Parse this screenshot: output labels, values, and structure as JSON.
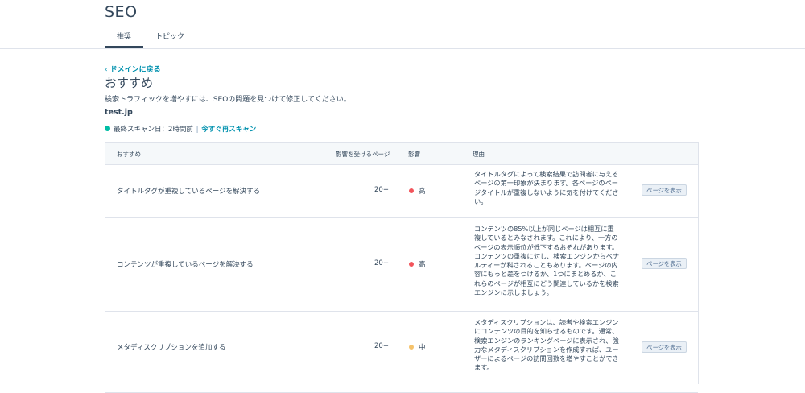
{
  "header": {
    "title": "SEO",
    "tabs": [
      {
        "label": "推奨",
        "active": true
      },
      {
        "label": "トピック",
        "active": false
      }
    ]
  },
  "main": {
    "back_link": "ドメインに戻る",
    "title": "おすすめ",
    "description": "検索トラフィックを増やすには、SEOの問題を見つけて修正してください。",
    "domain": "test.jp",
    "scan": {
      "last_scan": "最終スキャン日：2時間前",
      "separator": "|",
      "rescan_link": "今すぐ再スキャン",
      "status_color": "#00bda5"
    }
  },
  "table": {
    "headers": {
      "recommendation": "おすすめ",
      "pages": "影響を受けるページ",
      "impact": "影響",
      "reason": "理由"
    },
    "rows": [
      {
        "name": "タイトルタグが重複しているページを解決する",
        "pages": "20+",
        "impact": "高",
        "impact_color": "#f2545b",
        "reason": "タイトルタグによって検索結果で訪問者に与えるページの第一印象が決まります。各ページのページタイトルが重複しないように気を付けてください。",
        "button": "ページを表示"
      },
      {
        "name": "コンテンツが重複しているページを解決する",
        "pages": "20+",
        "impact": "高",
        "impact_color": "#f2545b",
        "reason": "コンテンツの85%以上が同じページは相互に重複しているとみなされます。これにより、一方のページの表示順位が低下するおそれがあります。コンテンツの重複に対し、検索エンジンからペナルティーが科されることもあります。ページの内容にもっと差をつけるか、1つにまとめるか、これらのページが相互にどう関連しているかを検索エンジンに示しましょう。",
        "button": "ページを表示"
      },
      {
        "name": "メタディスクリプションを追加する",
        "pages": "20+",
        "impact": "中",
        "impact_color": "#f5c26b",
        "reason": "メタディスクリプションは、読者や検索エンジンにコンテンツの目的を知らせるものです。通常、検索エンジンのランキングページに表示され、強力なメタディスクリプションを作成すれば、ユーザーによるページの訪問回数を増やすことができます。",
        "button": "ページを表示"
      }
    ]
  }
}
